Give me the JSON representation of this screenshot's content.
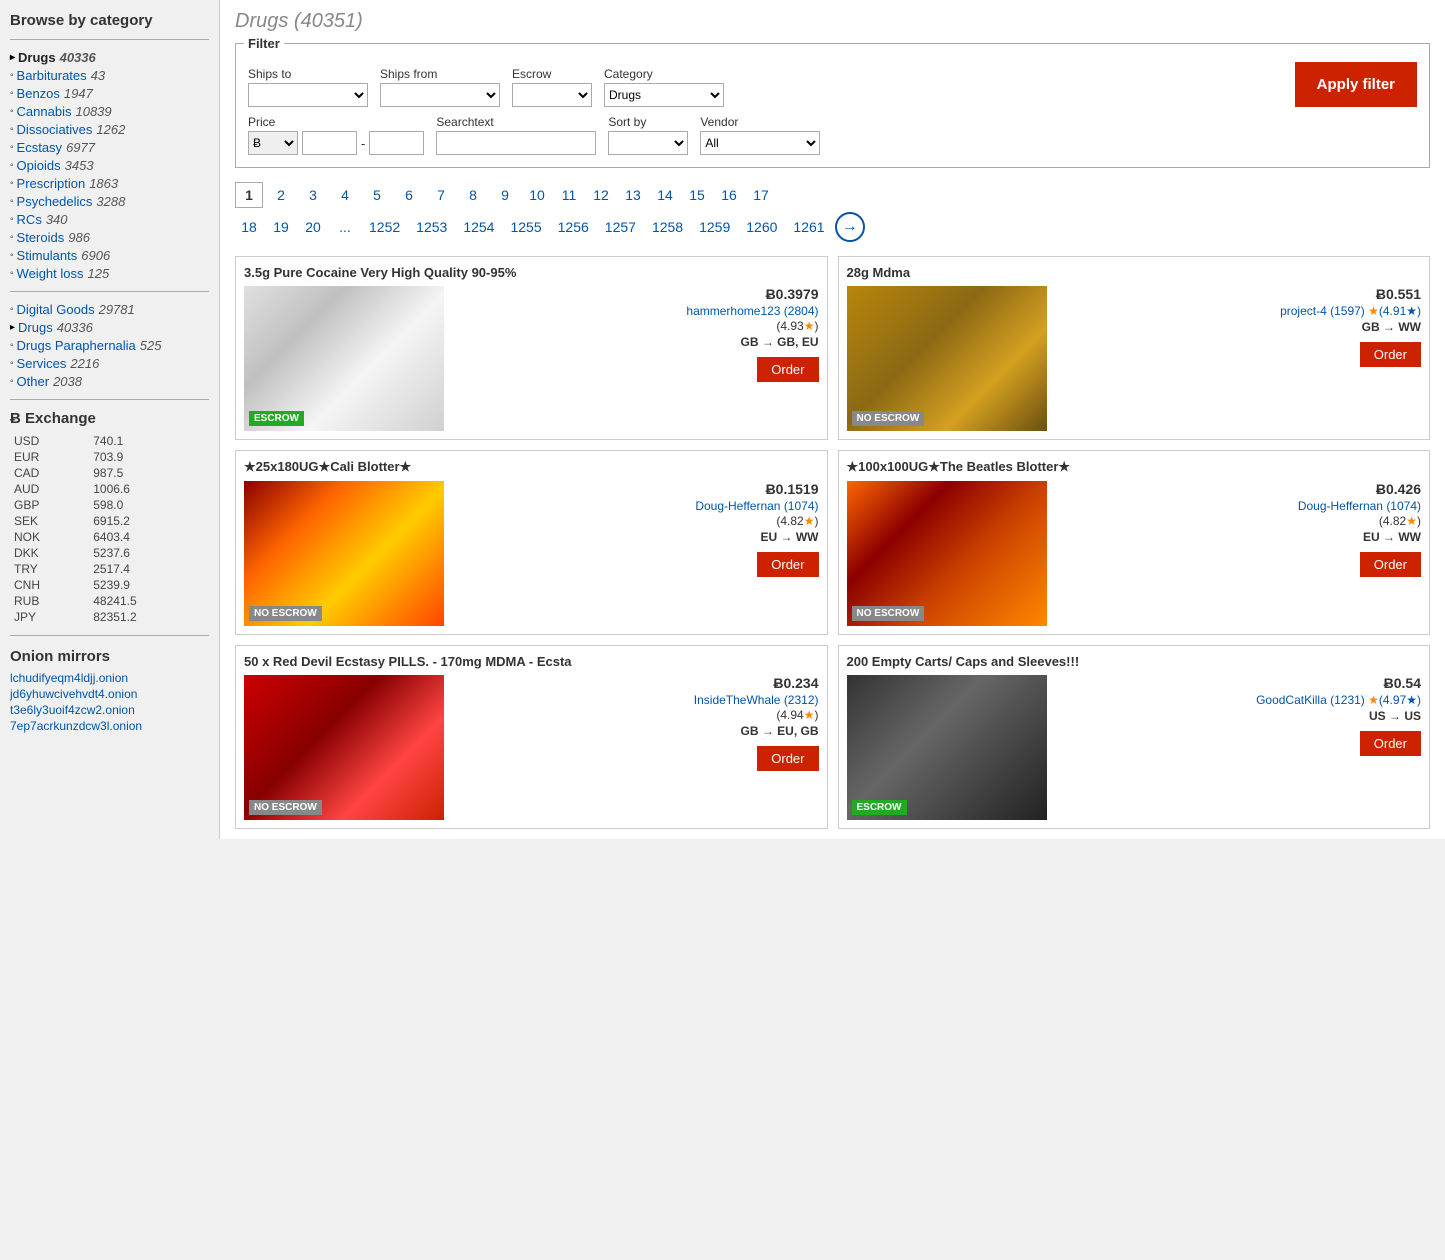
{
  "sidebar": {
    "browse_title": "Browse by category",
    "categories_primary": [
      {
        "label": "Drugs",
        "count": "40336",
        "active": true,
        "bullet": "▸"
      },
      {
        "label": "Barbiturates",
        "count": "43",
        "active": false,
        "bullet": "◦"
      },
      {
        "label": "Benzos",
        "count": "1947",
        "active": false,
        "bullet": "◦"
      },
      {
        "label": "Cannabis",
        "count": "10839",
        "active": false,
        "bullet": "◦"
      },
      {
        "label": "Dissociatives",
        "count": "1262",
        "active": false,
        "bullet": "◦"
      },
      {
        "label": "Ecstasy",
        "count": "6977",
        "active": false,
        "bullet": "◦"
      },
      {
        "label": "Opioids",
        "count": "3453",
        "active": false,
        "bullet": "◦"
      },
      {
        "label": "Prescription",
        "count": "1863",
        "active": false,
        "bullet": "◦"
      },
      {
        "label": "Psychedelics",
        "count": "3288",
        "active": false,
        "bullet": "◦"
      },
      {
        "label": "RCs",
        "count": "340",
        "active": false,
        "bullet": "◦"
      },
      {
        "label": "Steroids",
        "count": "986",
        "active": false,
        "bullet": "◦"
      },
      {
        "label": "Stimulants",
        "count": "6906",
        "active": false,
        "bullet": "◦"
      },
      {
        "label": "Weight loss",
        "count": "125",
        "active": false,
        "bullet": "◦"
      }
    ],
    "categories_secondary": [
      {
        "label": "Digital Goods",
        "count": "29781",
        "bullet": "◦"
      },
      {
        "label": "Drugs",
        "count": "40336",
        "bullet": "▸"
      },
      {
        "label": "Drugs Paraphernalia",
        "count": "525",
        "bullet": "◦"
      },
      {
        "label": "Services",
        "count": "2216",
        "bullet": "◦"
      },
      {
        "label": "Other",
        "count": "2038",
        "bullet": "◦"
      }
    ],
    "exchange_title": "Ƀ Exchange",
    "exchange_rates": [
      {
        "currency": "USD",
        "rate": "740.1"
      },
      {
        "currency": "EUR",
        "rate": "703.9"
      },
      {
        "currency": "CAD",
        "rate": "987.5"
      },
      {
        "currency": "AUD",
        "rate": "1006.6"
      },
      {
        "currency": "GBP",
        "rate": "598.0"
      },
      {
        "currency": "SEK",
        "rate": "6915.2"
      },
      {
        "currency": "NOK",
        "rate": "6403.4"
      },
      {
        "currency": "DKK",
        "rate": "5237.6"
      },
      {
        "currency": "TRY",
        "rate": "2517.4"
      },
      {
        "currency": "CNH",
        "rate": "5239.9"
      },
      {
        "currency": "RUB",
        "rate": "48241.5"
      },
      {
        "currency": "JPY",
        "rate": "82351.2"
      }
    ],
    "onion_title": "Onion mirrors",
    "onion_links": [
      "lchudifyeqm4ldjj.onion",
      "jd6yhuwcivehvdt4.onion",
      "t3e6ly3uoif4zcw2.onion",
      "7ep7acrkunzdcw3l.onion"
    ]
  },
  "main": {
    "page_title": "Drugs (40351)",
    "filter": {
      "legend": "Filter",
      "ships_to_label": "Ships to",
      "ships_from_label": "Ships from",
      "escrow_label": "Escrow",
      "category_label": "Category",
      "category_value": "Drugs",
      "price_label": "Price",
      "searchtext_label": "Searchtext",
      "sort_by_label": "Sort by",
      "vendor_label": "Vendor",
      "vendor_value": "All",
      "apply_label": "Apply filter"
    },
    "pagination": {
      "pages_row1": [
        "1",
        "2",
        "3",
        "4",
        "5",
        "6",
        "7",
        "8",
        "9",
        "10",
        "11",
        "12",
        "13",
        "14",
        "15",
        "16",
        "17"
      ],
      "pages_row2": [
        "18",
        "19",
        "20",
        "...",
        "1252",
        "1253",
        "1254",
        "1255",
        "1256",
        "1257",
        "1258",
        "1259",
        "1260",
        "1261"
      ]
    },
    "products": [
      {
        "id": 1,
        "title": "3.5g Pure Cocaine Very High Quality 90-95%",
        "price": "Ƀ0.3979",
        "vendor": "hammerhome123 (2804)",
        "rating": "(4.93★)",
        "shipping": "GB → GB, EU",
        "escrow": "ESCROW",
        "escrow_type": "escrow",
        "img_class": "img-cocaine"
      },
      {
        "id": 2,
        "title": "28g Mdma",
        "price": "Ƀ0.551",
        "vendor": "project-4 (1597) (4.91★)",
        "rating": "",
        "shipping": "GB → WW",
        "escrow": "NO ESCROW",
        "escrow_type": "no-escrow",
        "img_class": "img-mdma"
      },
      {
        "id": 3,
        "title": "★25x180UG★Cali Blotter★",
        "price": "Ƀ0.1519",
        "vendor": "Doug-Heffernan (1074)",
        "rating": "(4.82★)",
        "shipping": "EU → WW",
        "escrow": "NO ESCROW",
        "escrow_type": "no-escrow",
        "img_class": "img-blotter1"
      },
      {
        "id": 4,
        "title": "★100x100UG★The Beatles Blotter★",
        "price": "Ƀ0.426",
        "vendor": "Doug-Heffernan (1074)",
        "rating": "(4.82★)",
        "shipping": "EU → WW",
        "escrow": "NO ESCROW",
        "escrow_type": "no-escrow",
        "img_class": "img-blotter2"
      },
      {
        "id": 5,
        "title": "50 x Red Devil Ecstasy PILLS. - 170mg MDMA - Ecsta",
        "price": "Ƀ0.234",
        "vendor": "InsideTheWhale (2312)",
        "rating": "(4.94★)",
        "shipping": "GB → EU, GB",
        "escrow": "NO ESCROW",
        "escrow_type": "no-escrow",
        "img_class": "img-ecstasy"
      },
      {
        "id": 6,
        "title": "200 Empty Carts/ Caps and Sleeves!!!",
        "price": "Ƀ0.54",
        "vendor": "GoodCatKilla (1231) (4.97★)",
        "rating": "",
        "shipping": "US → US",
        "escrow": "ESCROW",
        "escrow_type": "escrow",
        "img_class": "img-carts"
      }
    ],
    "order_label": "Order"
  }
}
